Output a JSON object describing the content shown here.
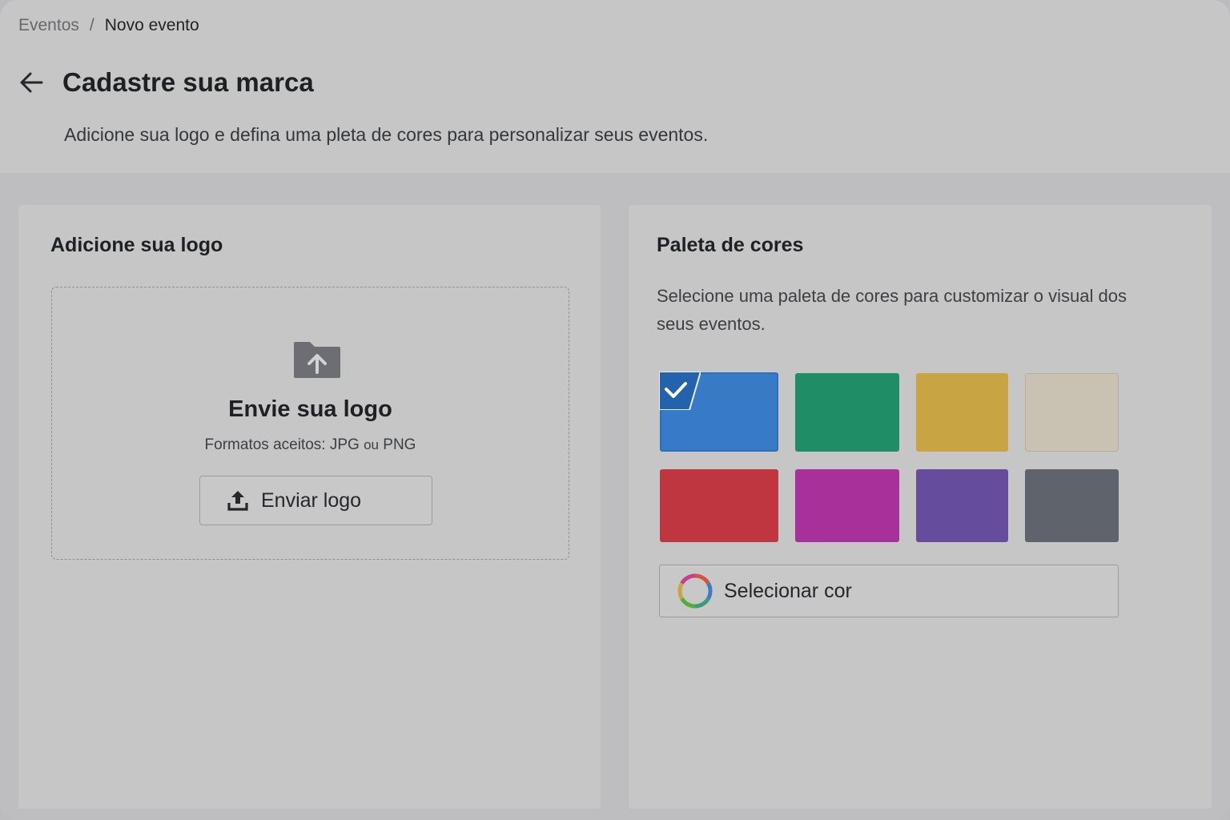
{
  "breadcrumb": {
    "parent": "Eventos",
    "separator": "/",
    "current": "Novo evento"
  },
  "header": {
    "back_icon": "arrow-left-icon",
    "title": "Cadastre sua marca",
    "subtitle": "Adicione sua logo e defina uma pleta de cores para personalizar seus eventos."
  },
  "logo_card": {
    "title": "Adicione sua logo",
    "dropzone": {
      "icon": "folder-upload-icon",
      "title": "Envie sua logo",
      "formats_prefix": "Formatos aceitos: JPG",
      "formats_or": "ou",
      "formats_suffix": "PNG",
      "button_icon": "upload-icon",
      "button_label": "Enviar logo"
    }
  },
  "palette_card": {
    "title": "Paleta de cores",
    "description": "Selecione uma paleta de cores para customizar o visual dos seus eventos.",
    "swatches": [
      {
        "name": "blue",
        "color": "#377ac6",
        "selected": true
      },
      {
        "name": "green",
        "color": "#1f8d66",
        "selected": false
      },
      {
        "name": "yellow",
        "color": "#c9a443",
        "selected": false
      },
      {
        "name": "beige",
        "color": "#c9c1b1",
        "selected": false
      },
      {
        "name": "red",
        "color": "#bf3540",
        "selected": false
      },
      {
        "name": "magenta",
        "color": "#a8309a",
        "selected": false
      },
      {
        "name": "purple",
        "color": "#654c9c",
        "selected": false
      },
      {
        "name": "gray",
        "color": "#5f646c",
        "selected": false
      }
    ],
    "custom_color_icon": "color-wheel-icon",
    "custom_color_label": "Selecionar cor"
  },
  "colors": {
    "accent": "#2b6fbf",
    "header_bg": "#c6c6c6",
    "page_bg": "#bebec0"
  }
}
